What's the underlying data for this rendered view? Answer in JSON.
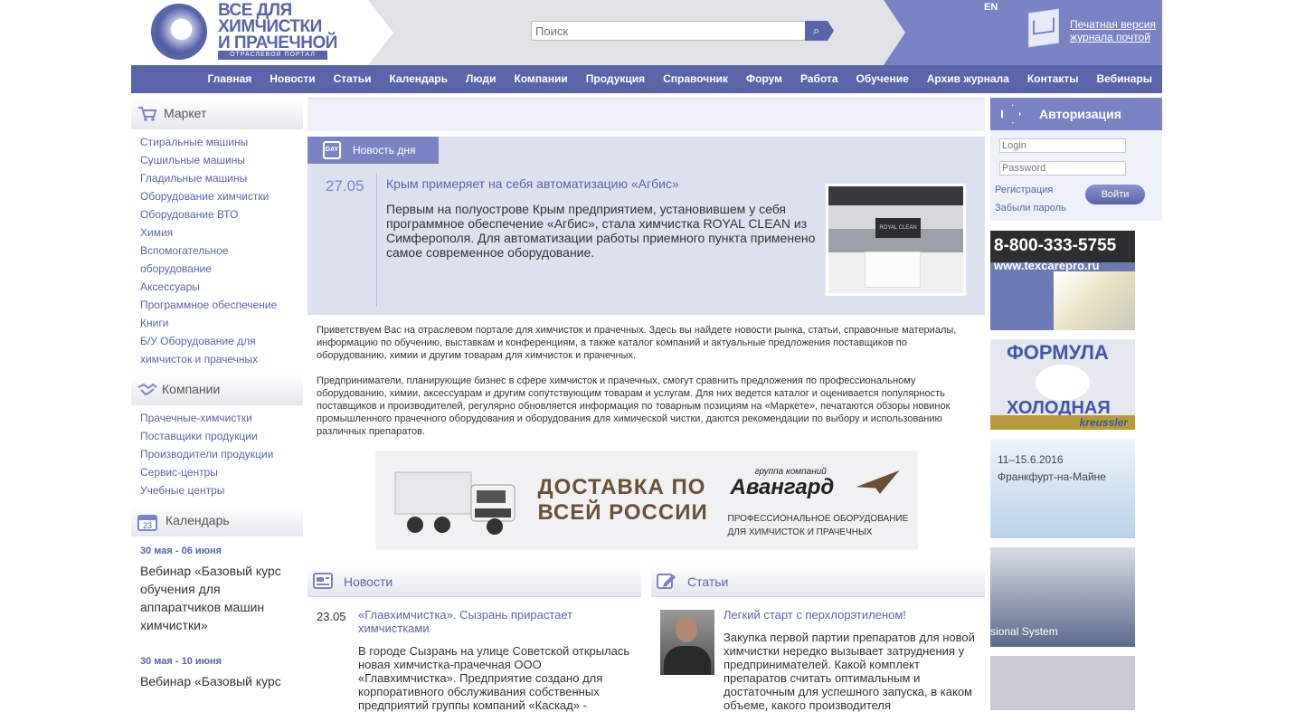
{
  "header": {
    "logo_line1": "ВСЕ ДЛЯ",
    "logo_line2": "ХИМЧИСТКИ",
    "logo_line3": "И ПРАЧЕЧНОЙ",
    "logo_sub": "ОТРАСЛЕВОЙ ПОРТАЛ",
    "search_placeholder": "Поиск",
    "lang": "EN",
    "print_line1": "Печатная версия",
    "print_line2": "журнала почтой"
  },
  "nav": [
    "Главная",
    "Новости",
    "Статьи",
    "Календарь",
    "Люди",
    "Компании",
    "Продукция",
    "Справочник",
    "Форум",
    "Работа",
    "Обучение",
    "Архив журнала",
    "Контакты",
    "Вебинары"
  ],
  "left": {
    "market": {
      "title": "Маркет",
      "items": [
        "Стиральные машины",
        "Сушильные машины",
        "Гладильные машины",
        "Оборудование химчистки",
        "Оборудование ВТО",
        "Химия",
        "Вспомогательное",
        "оборудование",
        "Аксессуары",
        "Программное обеспечение",
        "Книги",
        "Б/У Оборудование для",
        "химчисток и прачечных"
      ]
    },
    "companies": {
      "title": "Компании",
      "items": [
        "Прачечные-химчистки",
        "Поставщики продукции",
        "Производители продукции",
        "Сервис-центры",
        "Учебные центры"
      ]
    },
    "calendar": {
      "title": "Календарь",
      "icon_day": "23",
      "events": [
        {
          "date": "30 мая - 06 июня",
          "text": "Вебинар «Базовый курс обучения для аппаратчиков машин химчистки»"
        },
        {
          "date": "30 мая - 10 июня",
          "text": "Вебинар «Базовый курс"
        }
      ]
    }
  },
  "news_day": {
    "tab": "Новость дня",
    "date": "27.05",
    "title": "Крым примеряет на себя автоматизацию «Агбис»",
    "text": "Первым на полуострове Крым предприятием, установившем у себя программное обеспечение «Агбис», стала химчистка ROYAL CLEAN из Симферополя. Для автоматизации работы приемного пункта применено самое современное оборудование.",
    "image_sign": "ROYAL CLEAN"
  },
  "intro": {
    "p1": "Приветствуем Вас на отраслевом портале для химчисток и прачечных. Здесь вы найдете новости рынка, статьи, справочные материалы, информацию по обучению, выставкам и конференциям, а также каталог компаний и актуальные предложения поставщиков по оборудованию, химии и другим товарам для химчисток и прачечных.",
    "p2": "Предприниматели, планирующие бизнес в сфере химчисток и прачечных, смогут сравнить предложения по профессиональному оборудованию, химии, аксессуарам и другим сопутствующим товарам и услугам. Для них ведется каталог и оценивается популярность поставщиков и производителей, регулярно обновляется информация по товарным позициям на «Маркете», печатаются обзоры новинок промышленного прачечного оборудования и оборудования для химической чистки, даются рекомендации по выбору и использованию различных препаратов."
  },
  "banner": {
    "line1": "ДОСТАВКА ПО",
    "line2": "ВСЕЙ РОССИИ",
    "group": "группа компаний",
    "brand": "Авангард",
    "sub1": "ПРОФЕССИОНАЛЬНОЕ ОБОРУДОВАНИЕ",
    "sub2": "ДЛЯ ХИМЧИСТОК И ПРАЧЕЧНЫХ"
  },
  "news": {
    "title": "Новости",
    "item_date": "23.05",
    "item_title": "«Главхимчистка». Сызрань прирастает химчистками",
    "item_text": "В городе Сызрань на улице Советской открылась новая химчистка-прачечная ООО «Главхимчистка». Предприятие создано для корпоративного обслуживания собственных предприятий группы компаний «Каскад» -"
  },
  "articles": {
    "title": "Статьи",
    "item_title": "Легкий старт с перхлорэтиленом!",
    "item_text": "Закупка первой партии препаратов для новой химчистки нередко вызывает затруднения у предпринимателей. Какой комплект препаратов считать оптимальным и достаточным для успешного запуска, в каком объеме, какого производителя"
  },
  "auth": {
    "title": "Авторизация",
    "login_placeholder": "Login",
    "password_placeholder": "Password",
    "register": "Регистрация",
    "forgot": "Забыли пароль",
    "button": "Войти"
  },
  "ads": {
    "phone": "8-800-333-5755",
    "web": "www.texcarepro.ru",
    "formula": "ФОРМУЛА",
    "holodnaya": "ХОЛОДНАЯ",
    "kreussler": "kreussler",
    "dates": "11–15.6.2016",
    "city": "Франкфурт-на-Майне",
    "system": "sional System"
  }
}
